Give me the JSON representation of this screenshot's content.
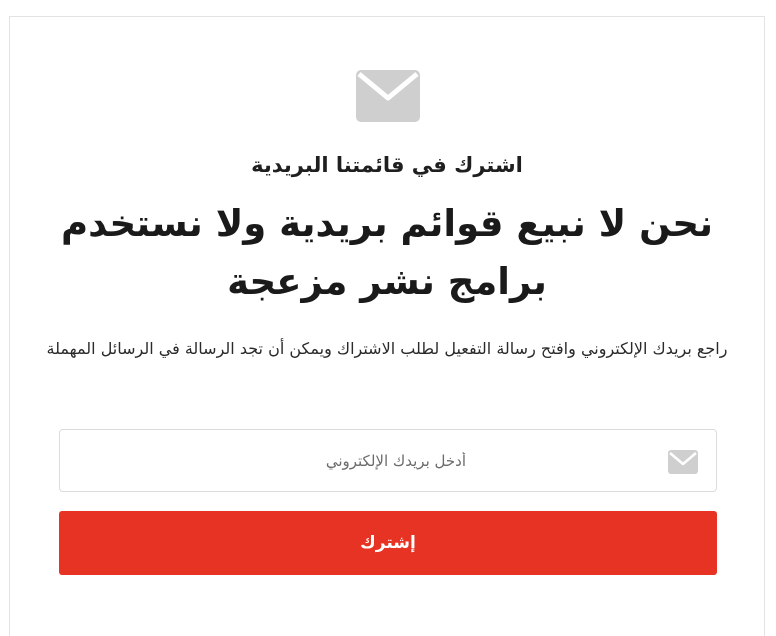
{
  "subscribe_card": {
    "hero_icon": "envelope-icon",
    "subtitle": "اشترك في قائمتنا البريدية",
    "headline": "نحن لا نبيع قوائم بريدية ولا نستخدم برامج نشر مزعجة",
    "description": "راجع بريدك الإلكتروني وافتح رسالة التفعيل لطلب الاشتراك ويمكن أن تجد الرسالة في الرسائل المهملة",
    "email_field": {
      "placeholder": "أدخل بريدك الإلكتروني",
      "value": "",
      "icon": "envelope-icon"
    },
    "submit_label": "إشترك"
  },
  "colors": {
    "accent": "#e63323",
    "icon_gray": "#cfcfcf",
    "border": "#dcdcdc",
    "text": "#1a1a1a"
  }
}
